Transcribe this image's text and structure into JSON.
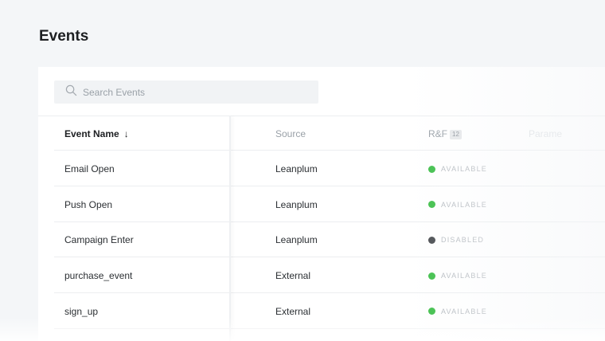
{
  "page": {
    "title": "Events"
  },
  "search": {
    "placeholder": "Search Events",
    "value": ""
  },
  "table": {
    "headers": {
      "name": "Event Name",
      "sort_arrow": "↓",
      "source": "Source",
      "rf": "R&F",
      "rf_count": "12",
      "params": "Parame"
    },
    "rows": [
      {
        "name": "Email Open",
        "source": "Leanplum",
        "status": "AVAILABLE",
        "status_color": "#3fbf4a"
      },
      {
        "name": "Push Open",
        "source": "Leanplum",
        "status": "AVAILABLE",
        "status_color": "#3fbf4a"
      },
      {
        "name": "Campaign Enter",
        "source": "Leanplum",
        "status": "DISABLED",
        "status_color": "#4a4d51"
      },
      {
        "name": "purchase_event",
        "source": "External",
        "status": "AVAILABLE",
        "status_color": "#3fbf4a"
      },
      {
        "name": "sign_up",
        "source": "External",
        "status": "AVAILABLE",
        "status_color": "#3fbf4a"
      }
    ]
  }
}
